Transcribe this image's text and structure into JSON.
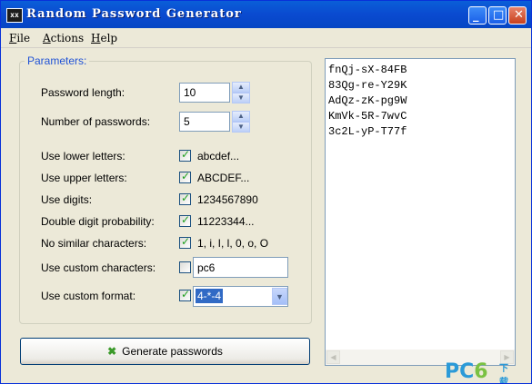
{
  "window": {
    "title": "Random Password Generator",
    "icon_text": "xx"
  },
  "menu": [
    {
      "accel": "F",
      "rest": "ile"
    },
    {
      "accel": "A",
      "rest": "ctions"
    },
    {
      "accel": "H",
      "rest": "elp"
    }
  ],
  "params": {
    "title": "Parameters:",
    "password_length": {
      "label": "Password length:",
      "value": "10"
    },
    "num_passwords": {
      "label": "Number of passwords:",
      "value": "5"
    },
    "lower": {
      "label": "Use lower letters:",
      "checked": true,
      "sample": "abcdef..."
    },
    "upper": {
      "label": "Use upper letters:",
      "checked": true,
      "sample": "ABCDEF..."
    },
    "digits": {
      "label": "Use digits:",
      "checked": true,
      "sample": "1234567890"
    },
    "double_digit": {
      "label": "Double digit probability:",
      "checked": true,
      "sample": "11223344..."
    },
    "no_similar": {
      "label": "No similar characters:",
      "checked": true,
      "sample": "1, i, I, l, 0, o, O"
    },
    "custom_chars": {
      "label": "Use custom characters:",
      "checked": false,
      "value": "pc6"
    },
    "custom_format": {
      "label": "Use custom format:",
      "checked": true,
      "value": "4-*-4"
    }
  },
  "generate_button": "Generate passwords",
  "output": [
    "fnQj-sX-84FB",
    "83Qg-re-Y29K",
    "AdQz-zK-pg9W",
    "KmVk-5R-7wvC",
    "3c2L-yP-T77f"
  ],
  "watermark": {
    "a": "PC",
    "b": "6",
    "c": "下载"
  },
  "icons": [
    "app-icon",
    "minimize-icon",
    "maximize-icon",
    "close-icon",
    "spin-up-icon",
    "spin-down-icon",
    "check-icon",
    "dropdown-arrow-icon",
    "generate-icon"
  ]
}
